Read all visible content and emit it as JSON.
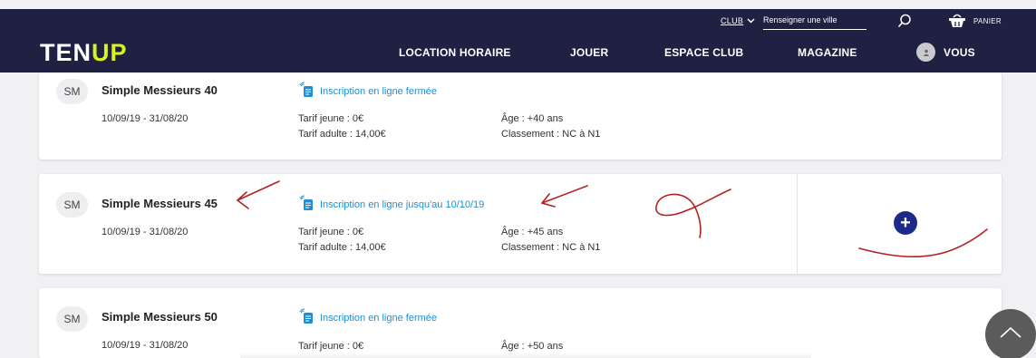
{
  "header": {
    "club_label": "CLUB",
    "city_placeholder": "Renseigner une ville",
    "basket_label": "PANIER",
    "logo_ten": "TEN",
    "logo_up": "UP",
    "nav": {
      "location": "LOCATION HORAIRE",
      "jouer": "JOUER",
      "espace_club": "ESPACE CLUB",
      "magazine": "MAGAZINE",
      "vous": "VOUS"
    }
  },
  "events": [
    {
      "badge": "SM",
      "name": "Simple Messieurs 40",
      "dates": "10/09/19 - 31/08/20",
      "inscription": "Inscription en ligne fermée",
      "tarif_jeune": "Tarif jeune : 0€",
      "tarif_adulte": "Tarif adulte : 14,00€",
      "age": "Âge : +40 ans",
      "classement": "Classement : NC à N1"
    },
    {
      "badge": "SM",
      "name": "Simple Messieurs 45",
      "dates": "10/09/19 - 31/08/20",
      "inscription": "Inscription en ligne jusqu'au 10/10/19",
      "tarif_jeune": "Tarif jeune : 0€",
      "tarif_adulte": "Tarif adulte : 14,00€",
      "age": "Âge : +45 ans",
      "classement": "Classement : NC à N1",
      "add_label": "+"
    },
    {
      "badge": "SM",
      "name": "Simple Messieurs 50",
      "dates": "10/09/19 - 31/08/20",
      "inscription": "Inscription en ligne fermée",
      "tarif_jeune": "Tarif jeune : 0€",
      "age": "Âge : +50 ans"
    }
  ],
  "colors": {
    "header_bg": "#1f2042",
    "logo_accent": "#d8f321",
    "link": "#1c8fd6",
    "add_button": "#1e2a8a",
    "annotation": "#b22222"
  },
  "icons": [
    "chevron-down-icon",
    "search-icon",
    "basket-icon",
    "form-icon",
    "plus-icon",
    "chevron-up-icon"
  ]
}
